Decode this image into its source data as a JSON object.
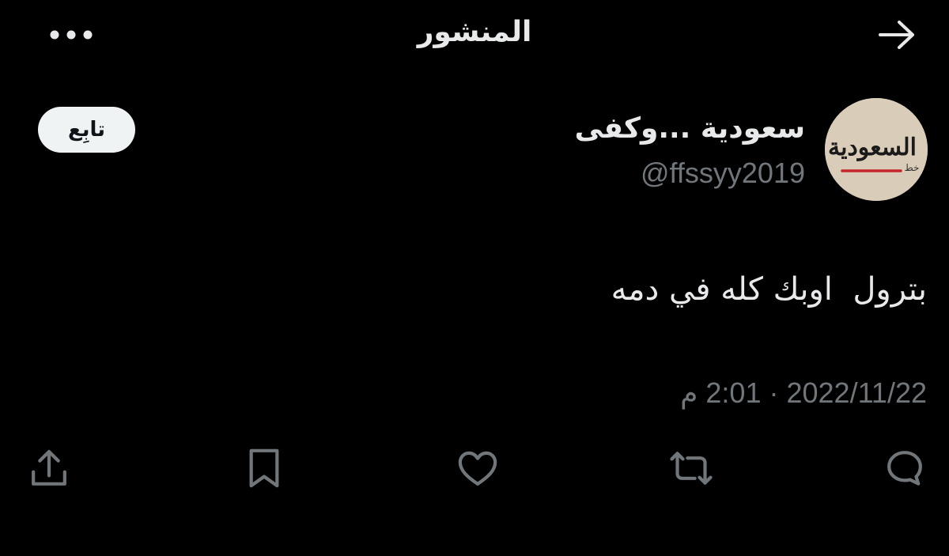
{
  "header": {
    "title": "المنشور",
    "back_icon": "arrow-right-icon",
    "more_icon": "more-dots-icon"
  },
  "author": {
    "display_name": "سعودية ...وكفى",
    "handle": "@ffssyy2019",
    "avatar_text": "السعودية",
    "avatar_small_text": "خط",
    "follow_label": "تابِع"
  },
  "post": {
    "text": "بترول  اوبك كله في دمه",
    "date": "2022/11/22",
    "separator": "·",
    "time": "2:01 م"
  },
  "actions": [
    {
      "icon": "reply-icon"
    },
    {
      "icon": "retweet-icon"
    },
    {
      "icon": "like-icon"
    },
    {
      "icon": "bookmark-icon"
    },
    {
      "icon": "share-icon"
    }
  ],
  "colors": {
    "background": "#000000",
    "text": "#e7e9ea",
    "secondary": "#71767b",
    "button_bg": "#eff3f4"
  }
}
